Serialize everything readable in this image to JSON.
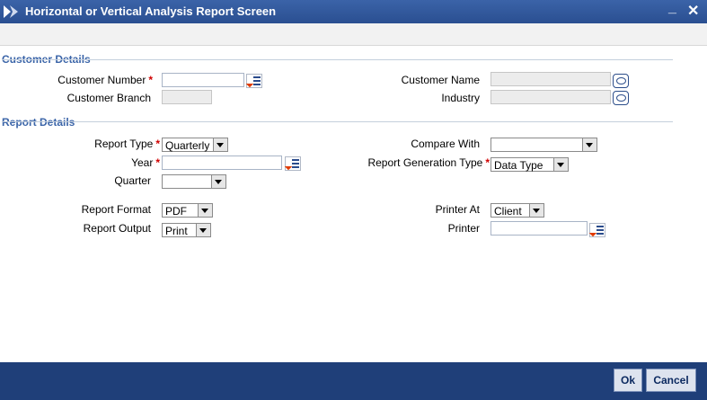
{
  "window": {
    "title": "Horizontal or Vertical Analysis Report Screen"
  },
  "sections": {
    "customer_details": "Customer Details",
    "report_details": "Report Details"
  },
  "customer": {
    "customer_number_label": "Customer Number",
    "customer_number_value": "",
    "customer_branch_label": "Customer Branch",
    "customer_branch_value": "",
    "customer_name_label": "Customer Name",
    "customer_name_value": "",
    "industry_label": "Industry",
    "industry_value": ""
  },
  "report": {
    "report_type_label": "Report Type",
    "report_type_value": "Quarterly",
    "year_label": "Year",
    "year_value": "",
    "quarter_label": "Quarter",
    "quarter_value": "",
    "compare_with_label": "Compare With",
    "compare_with_value": "",
    "generation_type_label": "Report Generation Type",
    "generation_type_value": "Data Type",
    "report_format_label": "Report Format",
    "report_format_value": "PDF",
    "report_output_label": "Report Output",
    "report_output_value": "Print",
    "printer_at_label": "Printer At",
    "printer_at_value": "Client",
    "printer_label": "Printer",
    "printer_value": ""
  },
  "required_mark": "*",
  "buttons": {
    "ok": "Ok",
    "cancel": "Cancel"
  },
  "controls": {
    "minimize": "_",
    "close": "✕"
  },
  "icons": {
    "app": "app-logo-icon",
    "lov": "list-of-values-icon",
    "lookup": "speech-bubble-icon"
  },
  "colors": {
    "title_bar": "#2f5699",
    "section_text": "#3a64a8",
    "footer": "#1f3f79",
    "required": "#d00000"
  }
}
